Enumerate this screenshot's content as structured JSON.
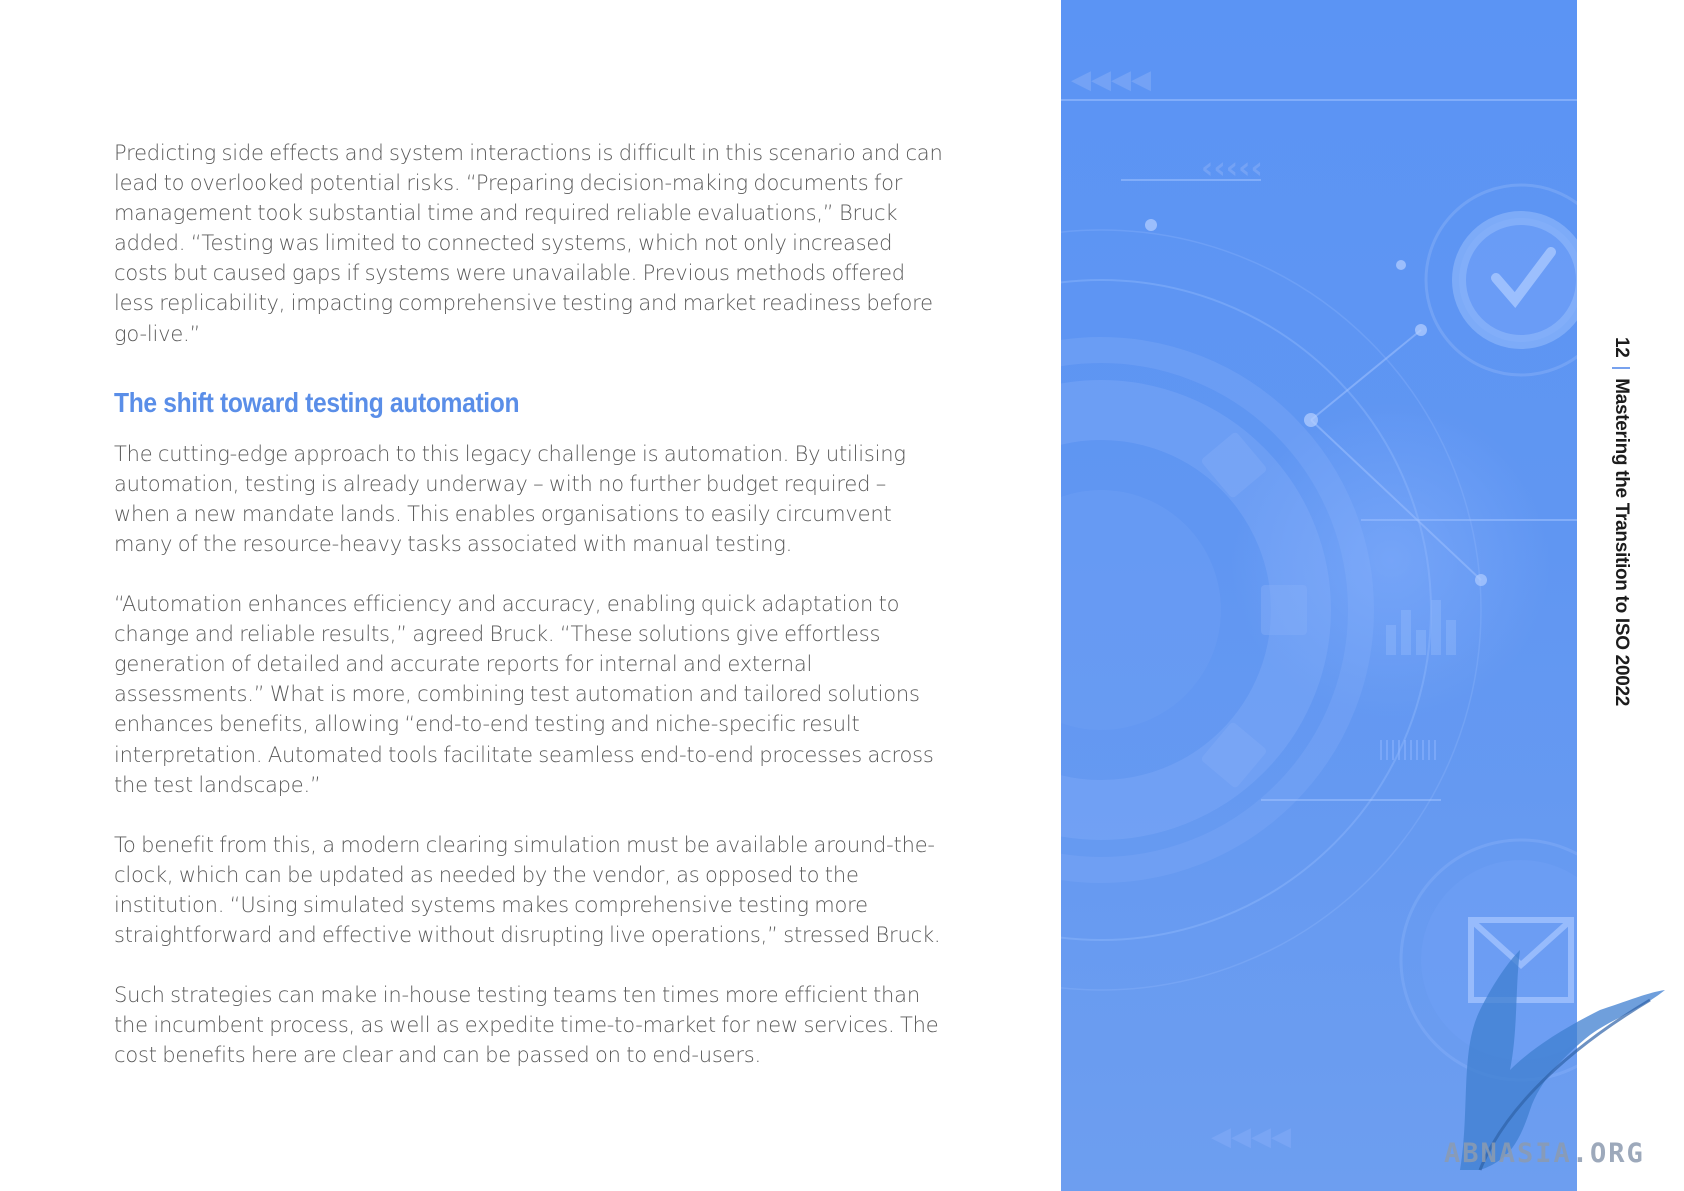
{
  "article": {
    "paragraph_1": "Predicting side effects and system interactions is difficult in this scenario and can lead to overlooked potential risks. “Preparing decision-making documents for management took substantial time and required reliable evaluations,” Bruck added. “Testing was limited to connected systems, which not only increased costs but caused gaps if systems were unavailable. Previous methods offered less replicability, impacting comprehensive testing and market readiness before go-live.”",
    "heading": "The shift toward testing automation",
    "paragraph_2": "The cutting-edge approach to this legacy challenge is automation. By utilising automation, testing is already underway – with no further budget required – when a new mandate lands. This enables organisations to easily circumvent many of the resource-heavy tasks associated with manual testing.",
    "paragraph_3": "“Automation enhances efficiency and accuracy, enabling quick adaptation to change and reliable results,” agreed Bruck. “These solutions give effortless generation of detailed and accurate reports for internal and external assessments.” What is more, combining test automation and tailored solutions enhances benefits, allowing “end-to-end testing and niche-specific result interpretation. Automated tools facilitate seamless end-to-end processes across the test landscape.”",
    "paragraph_4": "To benefit from this, a modern clearing simulation must be available around-the-clock, which can be updated as needed by the vendor, as opposed to the institution. “Using simulated systems makes comprehensive testing more straightforward and effective without disrupting live operations,” stressed Bruck.",
    "paragraph_5": "Such strategies can make in-house testing teams ten times more efficient than the incumbent process, as well as expedite time-to-market for new services. The cost benefits here are clear and can be passed on to end-users."
  },
  "sidebar": {
    "page_number": "12",
    "separator": "|",
    "document_title": "Mastering the Transition to ISO 20022"
  },
  "watermark": {
    "text": "ABNASIA.ORG"
  },
  "colors": {
    "heading": "#5a8ee8",
    "body_text": "#5a5a5a",
    "panel_blue": "#5b94f4",
    "accent": "#4f86e8"
  }
}
